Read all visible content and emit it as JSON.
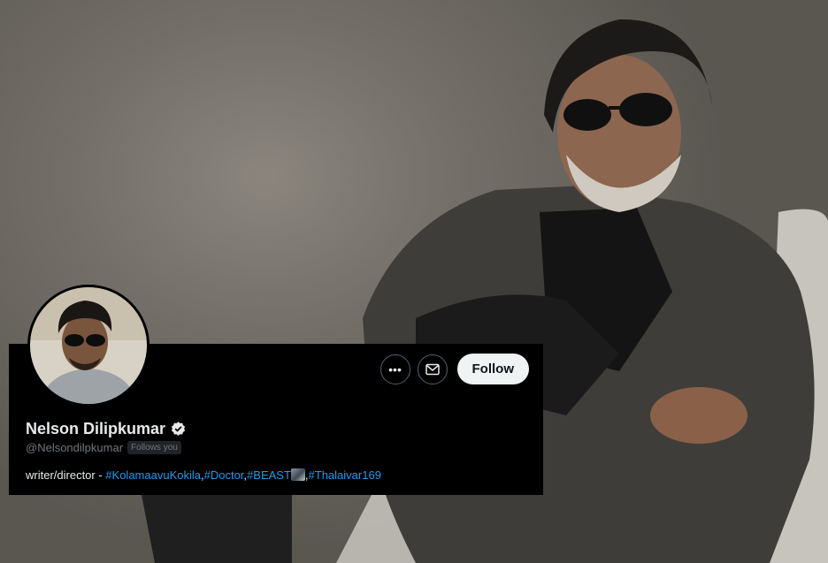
{
  "profile": {
    "name": "Nelson Dilipkumar",
    "handle": "@Nelsondilpkumar",
    "follows_you": "Follows you",
    "bio": {
      "prefix": "writer/director - ",
      "tags": [
        "#KolamaavuKokila",
        "#Doctor",
        "#BEAST",
        "#Thalaivar169"
      ],
      "separator": ","
    }
  },
  "actions": {
    "more_icon": "more-icon",
    "message_icon": "mail-icon",
    "follow_label": "Follow"
  },
  "colors": {
    "card_bg": "#000000",
    "link": "#1d9bf0",
    "muted": "#71767b",
    "follow_bg": "#eff3f4"
  }
}
